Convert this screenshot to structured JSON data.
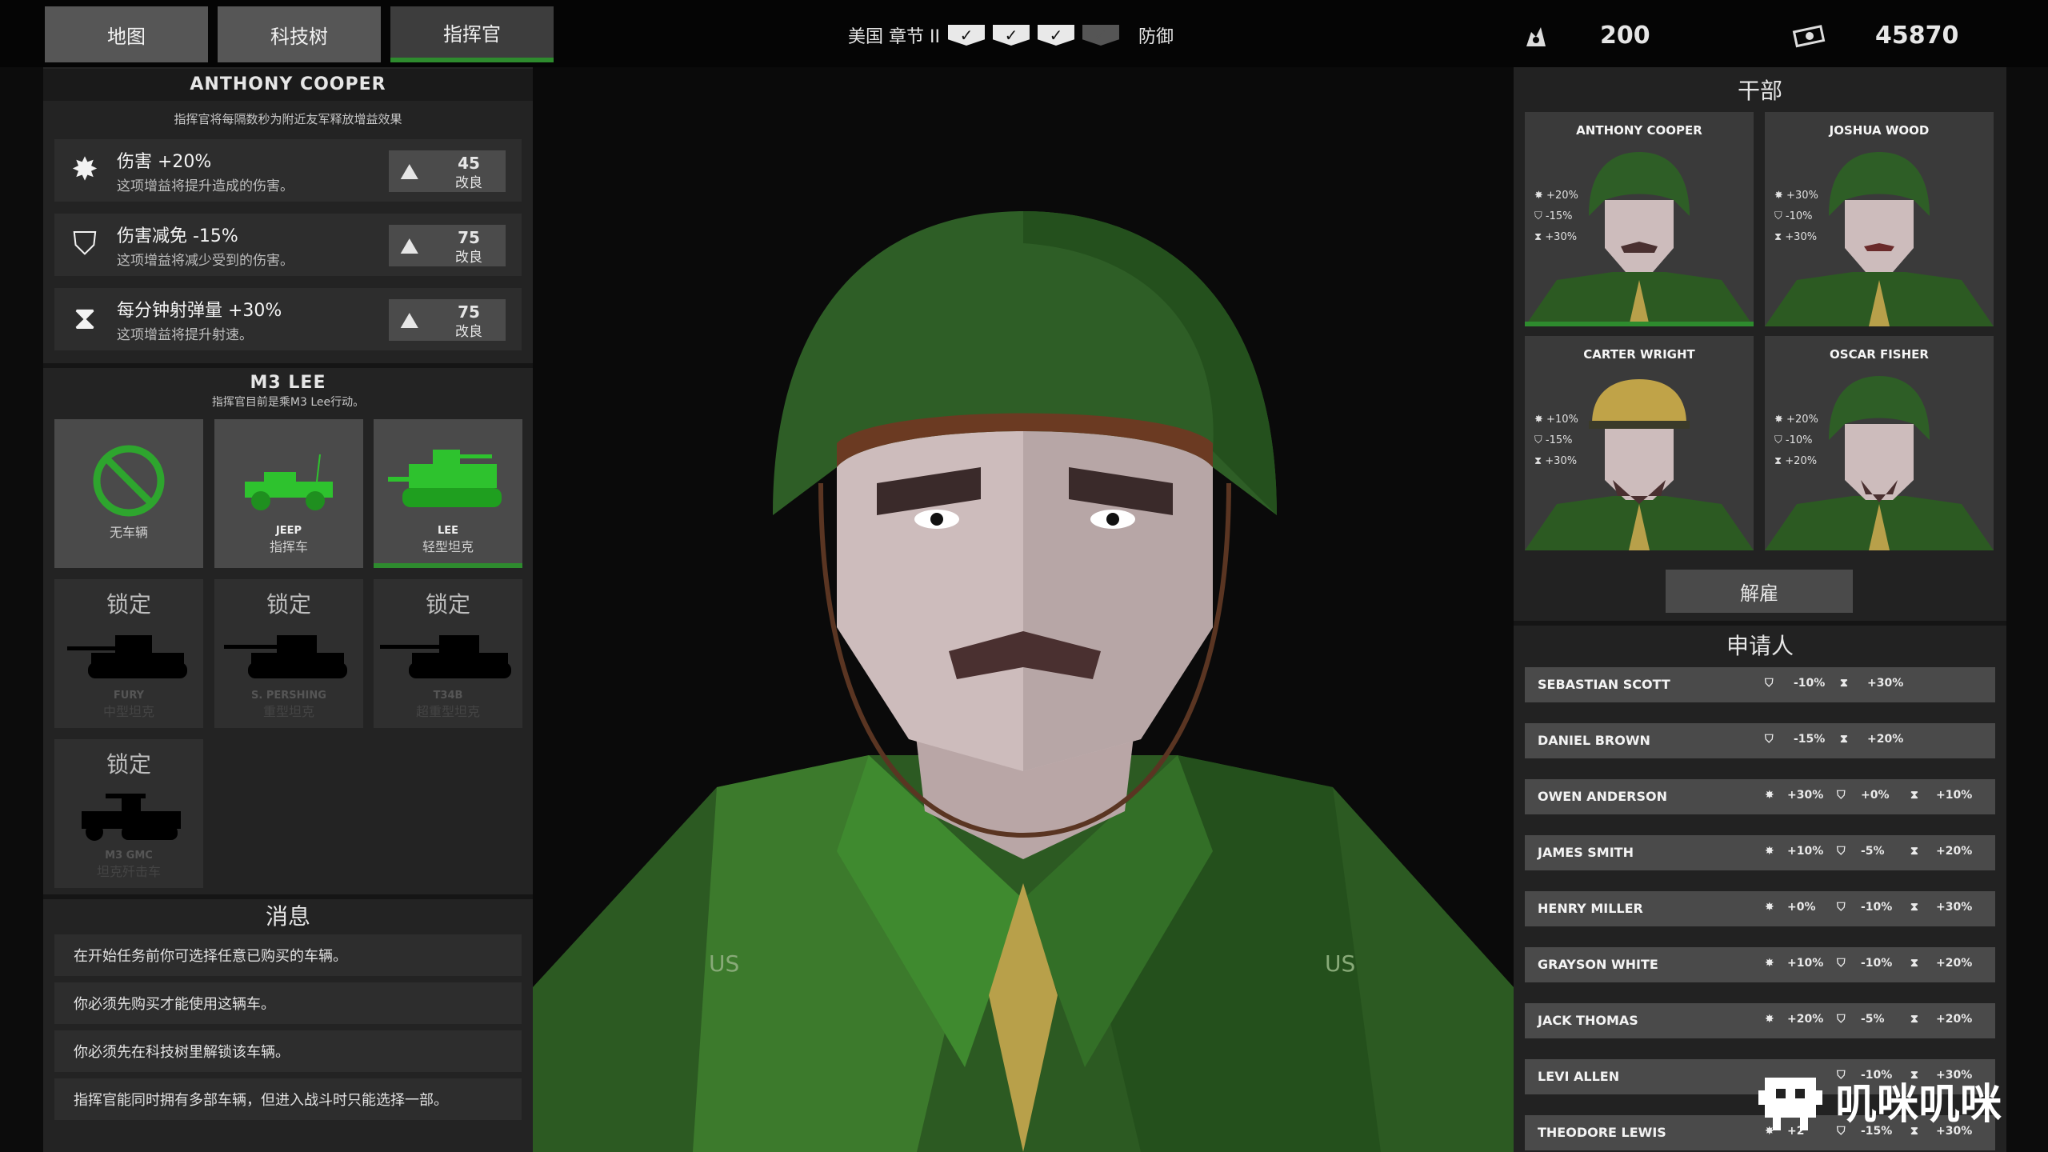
{
  "nav": {
    "tabs": [
      "地图",
      "科技树",
      "指挥官"
    ]
  },
  "chapter": {
    "label": "美国 章节 II",
    "mode": "防御"
  },
  "resources": {
    "parts": "200",
    "money": "45870"
  },
  "commander": {
    "name": "ANTHONY COOPER",
    "desc": "指挥官将每隔数秒为附近友军释放增益效果",
    "perks": [
      {
        "title": "伤害 +20%",
        "desc": "这项增益将提升造成的伤害。",
        "cost": "45",
        "action": "改良",
        "icon": "damage-icon"
      },
      {
        "title": "伤害减免 -15%",
        "desc": "这项增益将减少受到的伤害。",
        "cost": "75",
        "action": "改良",
        "icon": "shield-icon"
      },
      {
        "title": "每分钟射弹量 +30%",
        "desc": "这项增益将提升射速。",
        "cost": "75",
        "action": "改良",
        "icon": "hourglass-icon"
      }
    ]
  },
  "vehicle": {
    "name": "M3 LEE",
    "desc": "指挥官目前是乘M3 Lee行动。",
    "locked_label": "锁定",
    "items": [
      {
        "name": "",
        "sub": "无车辆",
        "locked": false
      },
      {
        "name": "JEEP",
        "sub": "指挥车",
        "locked": false
      },
      {
        "name": "LEE",
        "sub": "轻型坦克",
        "locked": false
      },
      {
        "name": "FURY",
        "sub": "中型坦克",
        "locked": true
      },
      {
        "name": "S. PERSHING",
        "sub": "重型坦克",
        "locked": true
      },
      {
        "name": "T34B",
        "sub": "超重型坦克",
        "locked": true
      },
      {
        "name": "M3 GMC",
        "sub": "坦克歼击车",
        "locked": true
      }
    ]
  },
  "messages": {
    "title": "消息",
    "items": [
      "在开始任务前你可选择任意已购买的车辆。",
      "你必须先购买才能使用这辆车。",
      "你必须先在科技树里解锁该车辆。",
      "指挥官能同时拥有多部车辆，但进入战斗时只能选择一部。"
    ]
  },
  "cadre": {
    "title": "干部",
    "members": [
      {
        "name": "ANTHONY COOPER",
        "stats": [
          "+20%",
          "-15%",
          "+30%"
        ]
      },
      {
        "name": "JOSHUA WOOD",
        "stats": [
          "+30%",
          "-10%",
          "+30%"
        ]
      },
      {
        "name": "CARTER WRIGHT",
        "stats": [
          "+10%",
          "-15%",
          "+30%"
        ]
      },
      {
        "name": "OSCAR FISHER",
        "stats": [
          "+20%",
          "-10%",
          "+20%"
        ]
      }
    ],
    "dismiss": "解雇"
  },
  "applicants": {
    "title": "申请人",
    "items": [
      {
        "name": "SEBASTIAN SCOTT",
        "stats": [
          "",
          "-10%",
          "+30%"
        ]
      },
      {
        "name": "DANIEL BROWN",
        "stats": [
          "",
          "-15%",
          "+20%"
        ]
      },
      {
        "name": "OWEN ANDERSON",
        "stats": [
          "+30%",
          "+0%",
          "+10%"
        ]
      },
      {
        "name": "JAMES SMITH",
        "stats": [
          "+10%",
          "-5%",
          "+20%"
        ]
      },
      {
        "name": "HENRY MILLER",
        "stats": [
          "+0%",
          "-10%",
          "+30%"
        ]
      },
      {
        "name": "GRAYSON WHITE",
        "stats": [
          "+10%",
          "-10%",
          "+20%"
        ]
      },
      {
        "name": "JACK THOMAS",
        "stats": [
          "+20%",
          "-5%",
          "+20%"
        ]
      },
      {
        "name": "LEVI ALLEN",
        "stats": [
          "",
          "-10%",
          "+30%"
        ]
      },
      {
        "name": "THEODORE LEWIS",
        "stats": [
          "+2",
          "-15%",
          "+30%"
        ]
      }
    ]
  },
  "watermark": "叽咪叽咪",
  "uniform_mark": "US"
}
